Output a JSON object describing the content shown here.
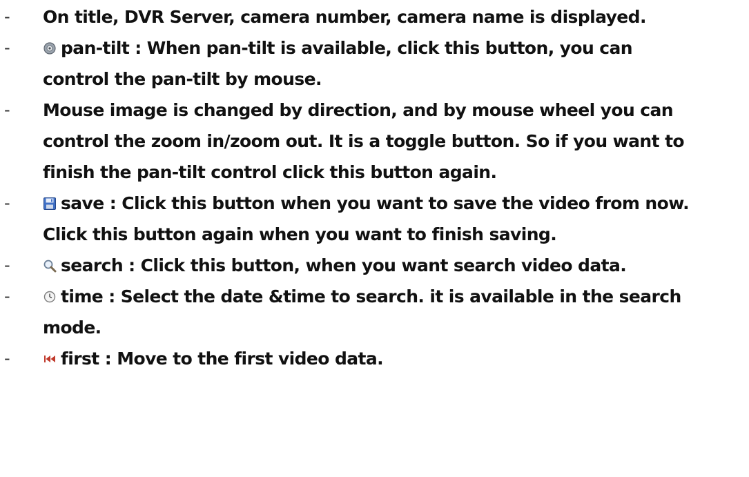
{
  "items": [
    {
      "dash": "-",
      "icon": null,
      "lines": [
        "On title, DVR Server, camera number, camera name is displayed."
      ]
    },
    {
      "dash": "-",
      "icon": "pan-tilt-icon",
      "lines": [
        "pan-tilt : When pan-tilt is available, click this button, you can",
        "control  the pan-tilt by mouse."
      ]
    },
    {
      "dash": "-",
      "icon": null,
      "lines": [
        "Mouse image is changed by direction, and by mouse wheel you can",
        "control the zoom in/zoom out. It is a toggle button. So if you want to",
        "finish the pan-tilt control click this button again."
      ]
    },
    {
      "dash": "-",
      "icon": "save-disk-icon",
      "lines": [
        "save : Click this button when you want to save the video from now.",
        "Click this button again when you want to finish saving."
      ]
    },
    {
      "dash": "-",
      "icon": "search-magnifier-icon",
      "lines": [
        "search : Click this button, when you want search video data."
      ]
    },
    {
      "dash": "-",
      "icon": "clock-icon",
      "lines": [
        "time : Select the date &time to search. it is available in the search",
        "mode."
      ]
    },
    {
      "dash": "-",
      "icon": "first-skip-icon",
      "lines": [
        "first : Move to the first video data."
      ]
    }
  ]
}
